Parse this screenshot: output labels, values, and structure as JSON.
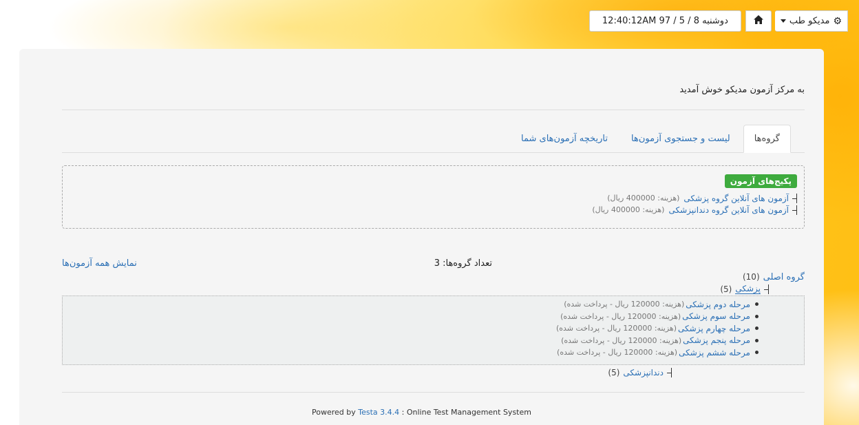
{
  "topbar": {
    "user_label": "مدیکو طب",
    "user_icon": "gear-icon",
    "home_icon": "home-icon",
    "datetime": "دوشنبه 8 / 5 / 97  12:40:12AM"
  },
  "welcome": "به مرکز آزمون مدیکو خوش آمدید",
  "tabs": [
    {
      "label": "گروه‌ها",
      "active": true
    },
    {
      "label": "لیست و جستجوی آزمون‌ها",
      "active": false
    },
    {
      "label": "تاریخچه آزمون‌های شما",
      "active": false
    }
  ],
  "packages": {
    "title": "پکیج‌های آزمون",
    "items": [
      {
        "name": "آزمون های آنلاین گروه پزشکی",
        "price": "(هزینه: 400000 ریال)"
      },
      {
        "name": "آزمون های آنلاین گروه دندانپزشکی",
        "price": "(هزینه: 400000 ریال)"
      }
    ]
  },
  "groups": {
    "count_label": "تعداد گروه‌ها: 3",
    "show_all": "نمایش همه آزمون‌ها",
    "root": {
      "name": "گروه اصلی",
      "count": "(10)"
    },
    "subgroups": [
      {
        "name": "پزشکی",
        "count": "(5)"
      },
      {
        "name": "دندانپزشکی",
        "count": "(5)"
      }
    ],
    "exams": [
      {
        "name": "مرحله دوم پزشکی",
        "detail": "(هزینه: 120000 ریال - پرداخت شده)"
      },
      {
        "name": "مرحله سوم پزشکی",
        "detail": "(هزینه: 120000 ریال - پرداخت شده)"
      },
      {
        "name": "مرحله چهارم پزشکی",
        "detail": "(هزینه: 120000 ریال - پرداخت شده)"
      },
      {
        "name": "مرحله پنجم پزشکی",
        "detail": "(هزینه: 120000 ریال - پرداخت شده)"
      },
      {
        "name": "مرحله ششم پزشکی",
        "detail": "(هزینه: 120000 ریال - پرداخت شده)"
      }
    ]
  },
  "footer": {
    "prefix": "Powered by",
    "product": "Testa 3.4.4",
    "suffix": ": Online Test Management System"
  }
}
